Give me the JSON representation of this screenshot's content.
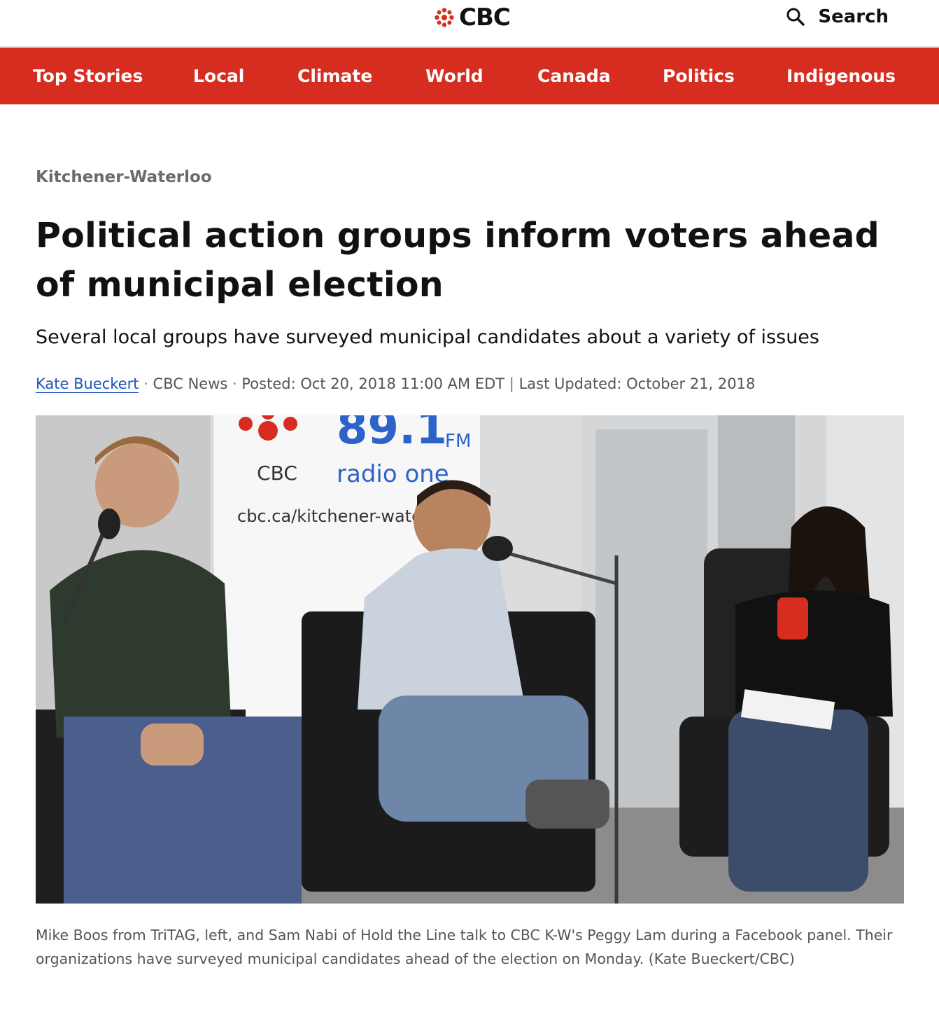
{
  "header": {
    "logo_text": "CBC",
    "search_label": "Search",
    "brand_color": "#d62d20"
  },
  "nav": {
    "items": [
      {
        "label": "Top Stories"
      },
      {
        "label": "Local"
      },
      {
        "label": "Climate"
      },
      {
        "label": "World"
      },
      {
        "label": "Canada"
      },
      {
        "label": "Politics"
      },
      {
        "label": "Indigenous"
      }
    ]
  },
  "article": {
    "section": "Kitchener-Waterloo",
    "headline": "Political action groups inform voters ahead of municipal election",
    "deck": "Several local groups have surveyed municipal candidates about a variety of issues",
    "byline": {
      "author": "Kate Bueckert",
      "outlet": "CBC News",
      "posted": "Posted: Oct 20, 2018 11:00 AM EDT",
      "updated": "Last Updated: October 21, 2018"
    },
    "photo": {
      "backdrop_brand": "CBC",
      "backdrop_frequency": "89.1",
      "backdrop_band": "FM",
      "backdrop_station": "radio one",
      "backdrop_url": "cbc.ca/kitchener-waterloo"
    },
    "caption": "Mike Boos from TriTAG, left, and Sam Nabi of Hold the Line talk to CBC K-W's Peggy Lam during a Facebook panel. Their organizations have surveyed municipal candidates ahead of the election on Monday. (Kate Bueckert/CBC)"
  }
}
